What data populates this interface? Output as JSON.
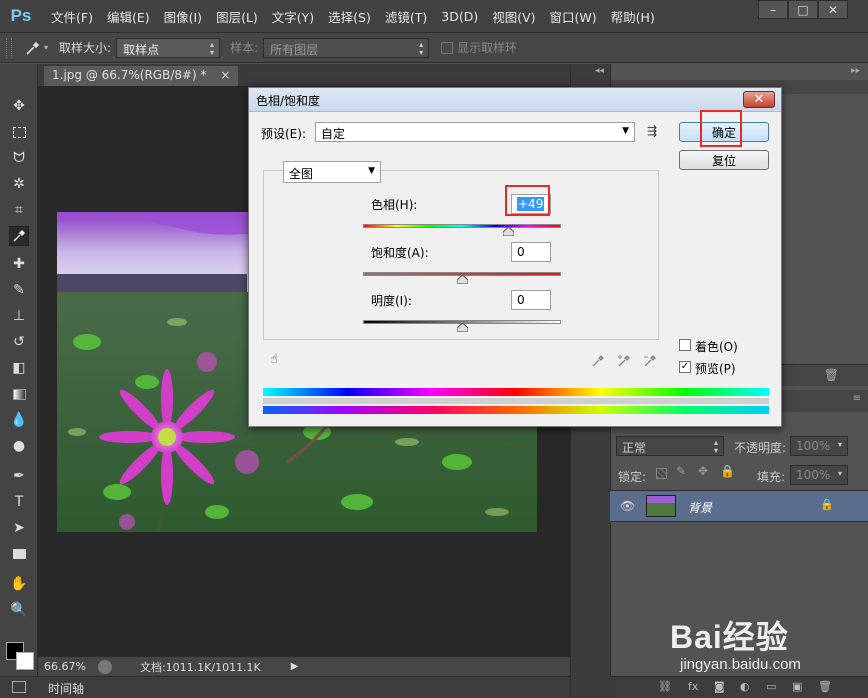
{
  "app": {
    "logo": "Ps",
    "menu": [
      "文件(F)",
      "编辑(E)",
      "图像(I)",
      "图层(L)",
      "文字(Y)",
      "选择(S)",
      "滤镜(T)",
      "3D(D)",
      "视图(V)",
      "窗口(W)",
      "帮助(H)"
    ],
    "window_buttons": {
      "minimize": "–",
      "maximize": "□",
      "close": "✕"
    }
  },
  "options_bar": {
    "sample_size_label": "取样大小:",
    "sample_size_value": "取样点",
    "sample_label": "样本:",
    "sample_value": "所有图层",
    "show_ring_label": "显示取样环"
  },
  "document": {
    "tab_title": "1.jpg @ 66.7%(RGB/8#) *",
    "tab_close": "×",
    "zoom": "66.67%",
    "doc_info": "文档:1011.1K/1011.1K",
    "timeline_label": "时间轴"
  },
  "dialog": {
    "title": "色相/饱和度",
    "close": "✕",
    "preset_label": "预设(E):",
    "preset_value": "自定",
    "ok_button": "确定",
    "reset_button": "复位",
    "channel_value": "全图",
    "hue_label": "色相(H):",
    "hue_value": "+49",
    "saturation_label": "饱和度(A):",
    "saturation_value": "0",
    "lightness_label": "明度(I):",
    "lightness_value": "0",
    "colorize_label": "着色(O)",
    "preview_label": "预览(P)",
    "preview_checked": "✓"
  },
  "layers_panel": {
    "blend_mode": "正常",
    "opacity_label": "不透明度:",
    "opacity_value": "100%",
    "lock_label": "锁定:",
    "fill_label": "填充:",
    "fill_value": "100%",
    "layer_name": "背景"
  },
  "watermark": {
    "brand": "Bai经验",
    "url": "jingyan.baidu.com"
  },
  "colors": {
    "red_highlight": "#e8282b",
    "selection_blue": "#3399ff",
    "layer_selected": "#5b6d8d"
  }
}
